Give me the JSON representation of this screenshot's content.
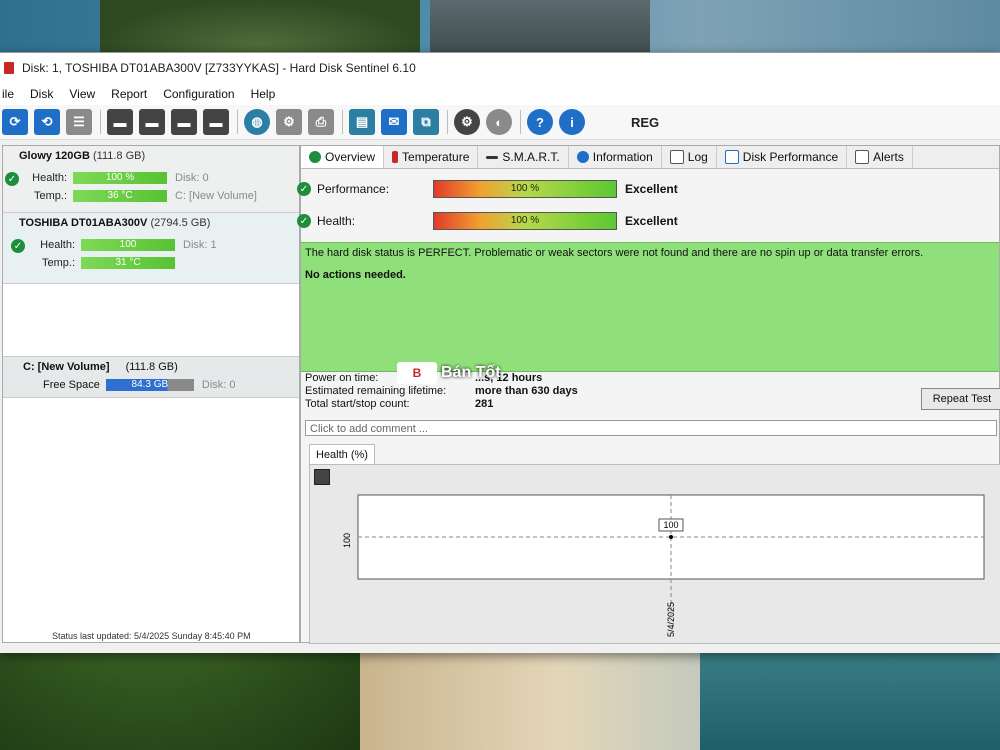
{
  "window": {
    "title": "Disk: 1, TOSHIBA DT01ABA300V [Z733YYKAS] - Hard Disk Sentinel 6.10"
  },
  "menu": [
    "ile",
    "Disk",
    "View",
    "Report",
    "Configuration",
    "Help"
  ],
  "toolbar": {
    "reg_label": "REG"
  },
  "disks": [
    {
      "name": "Glowy 120GB",
      "size": "(111.8 GB)",
      "health_label": "Health:",
      "health_value": "100 %",
      "health_pct": 100,
      "health_disk": "Disk: 0",
      "temp_label": "Temp.:",
      "temp_value": "36 °C",
      "volume": "C: [New Volume]"
    },
    {
      "name": "TOSHIBA DT01ABA300V",
      "size": "(2794.5 GB)",
      "health_label": "Health:",
      "health_value": "100",
      "health_pct": 100,
      "health_disk": "Disk: 1",
      "temp_label": "Temp.:",
      "temp_value": "31 °C"
    }
  ],
  "volume": {
    "name": "C: [New Volume]",
    "size": "(111.8 GB)",
    "free_label": "Free Space",
    "free_value": "84.3 GB",
    "disk": "Disk: 0"
  },
  "statusbar": "Status last updated: 5/4/2025 Sunday 8:45:40 PM",
  "tabs": [
    "Overview",
    "Temperature",
    "S.M.A.R.T.",
    "Information",
    "Log",
    "Disk Performance",
    "Alerts"
  ],
  "overview": {
    "performance_label": "Performance:",
    "performance_value": "100 %",
    "performance_pct": 100,
    "performance_rating": "Excellent",
    "health_label": "Health:",
    "health_value": "100 %",
    "health_pct": 100,
    "health_rating": "Excellent",
    "status_text": "The hard disk status is PERFECT. Problematic or weak sectors were not found and there are no spin up or data transfer errors.",
    "actions_text": "No actions needed.",
    "power_on_label": "Power on time:",
    "power_on_value": "...s, 12 hours",
    "remaining_label": "Estimated remaining lifetime:",
    "remaining_value": "more than 630 days",
    "startstop_label": "Total start/stop count:",
    "startstop_value": "281",
    "repeat_button": "Repeat Test",
    "comment_placeholder": "Click to add comment ..."
  },
  "watermark": {
    "text": "Bán Tốt"
  },
  "chart_data": {
    "type": "line",
    "title": "Health (%)",
    "x": [
      "5/4/2025"
    ],
    "series": [
      {
        "values": [
          100
        ]
      }
    ],
    "ylabel": "",
    "y_tick": "100",
    "point_label": "100",
    "ylim": [
      99,
      101
    ]
  }
}
